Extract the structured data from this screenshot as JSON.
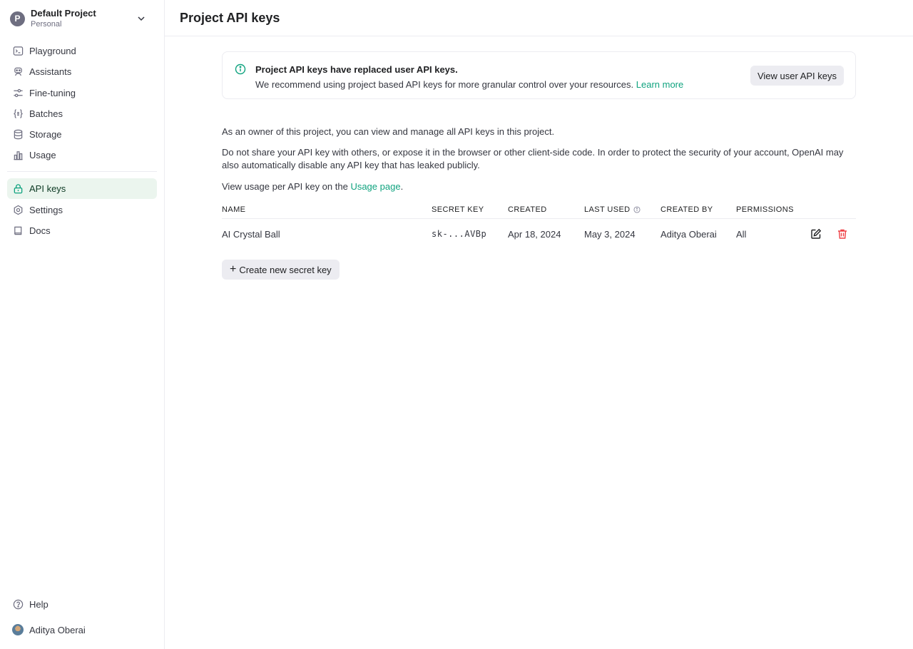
{
  "project": {
    "avatar_letter": "P",
    "name": "Default Project",
    "type": "Personal"
  },
  "sidebar": {
    "items": [
      {
        "label": "Playground",
        "icon": "terminal-icon"
      },
      {
        "label": "Assistants",
        "icon": "robot-icon"
      },
      {
        "label": "Fine-tuning",
        "icon": "sliders-icon"
      },
      {
        "label": "Batches",
        "icon": "braces-icon"
      },
      {
        "label": "Storage",
        "icon": "database-icon"
      },
      {
        "label": "Usage",
        "icon": "bar-chart-icon"
      }
    ],
    "items2": [
      {
        "label": "API keys",
        "icon": "lock-icon",
        "active": true
      },
      {
        "label": "Settings",
        "icon": "gear-icon"
      },
      {
        "label": "Docs",
        "icon": "book-icon"
      }
    ],
    "help_label": "Help",
    "user_name": "Aditya Oberai"
  },
  "header": {
    "title": "Project API keys"
  },
  "banner": {
    "title": "Project API keys have replaced user API keys.",
    "text": "We recommend using project based API keys for more granular control over your resources.",
    "link": "Learn more",
    "button": "View user API keys"
  },
  "body": {
    "p1": "As an owner of this project, you can view and manage all API keys in this project.",
    "p2": "Do not share your API key with others, or expose it in the browser or other client-side code. In order to protect the security of your account, OpenAI may also automatically disable any API key that has leaked publicly.",
    "p3_prefix": "View usage per API key on the ",
    "p3_link": "Usage page",
    "p3_suffix": "."
  },
  "table": {
    "headers": {
      "name": "NAME",
      "secret": "SECRET KEY",
      "created": "CREATED",
      "last_used": "LAST USED",
      "created_by": "CREATED BY",
      "permissions": "PERMISSIONS"
    },
    "rows": [
      {
        "name": "AI Crystal Ball",
        "secret": "sk-...AVBp",
        "created": "Apr 18, 2024",
        "last_used": "May 3, 2024",
        "created_by": "Aditya Oberai",
        "permissions": "All"
      }
    ]
  },
  "create_button": "Create new secret key",
  "colors": {
    "accent": "#10a37f",
    "danger": "#ef4146",
    "active_bg": "#ebf5ee"
  }
}
